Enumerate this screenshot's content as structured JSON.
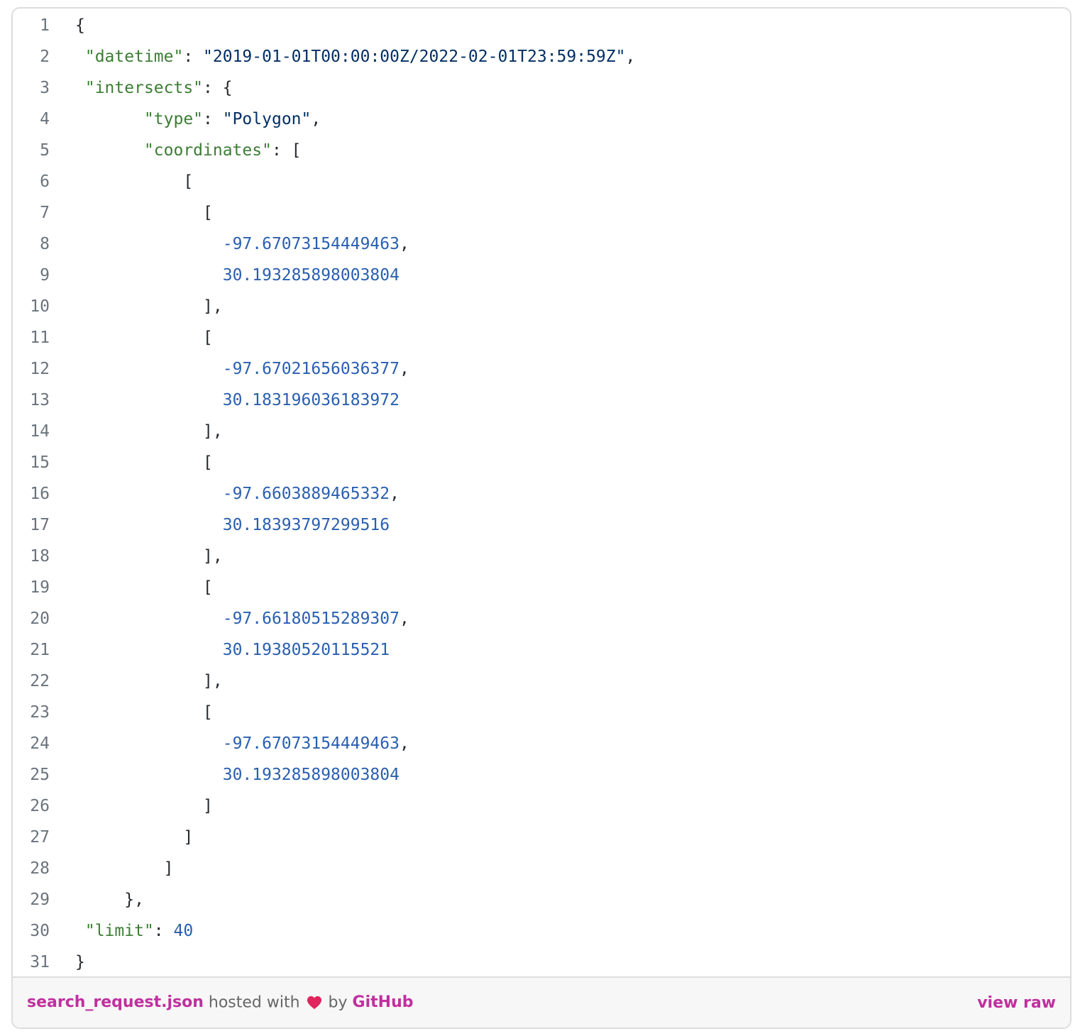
{
  "lines": [
    {
      "n": "1",
      "indent": "",
      "tokens": [
        {
          "t": "{",
          "c": "p"
        }
      ]
    },
    {
      "n": "2",
      "indent": " ",
      "tokens": [
        {
          "t": "\"datetime\"",
          "c": "k"
        },
        {
          "t": ": ",
          "c": "p"
        },
        {
          "t": "\"2019-01-01T00:00:00Z/2022-02-01T23:59:59Z\"",
          "c": "s"
        },
        {
          "t": ",",
          "c": "p"
        }
      ]
    },
    {
      "n": "3",
      "indent": " ",
      "tokens": [
        {
          "t": "\"intersects\"",
          "c": "k"
        },
        {
          "t": ": {",
          "c": "p"
        }
      ]
    },
    {
      "n": "4",
      "indent": "       ",
      "tokens": [
        {
          "t": "\"type\"",
          "c": "k"
        },
        {
          "t": ": ",
          "c": "p"
        },
        {
          "t": "\"Polygon\"",
          "c": "s"
        },
        {
          "t": ",",
          "c": "p"
        }
      ]
    },
    {
      "n": "5",
      "indent": "       ",
      "tokens": [
        {
          "t": "\"coordinates\"",
          "c": "k"
        },
        {
          "t": ": [",
          "c": "p"
        }
      ]
    },
    {
      "n": "6",
      "indent": "           ",
      "tokens": [
        {
          "t": "[",
          "c": "p"
        }
      ]
    },
    {
      "n": "7",
      "indent": "             ",
      "tokens": [
        {
          "t": "[",
          "c": "p"
        }
      ]
    },
    {
      "n": "8",
      "indent": "               ",
      "tokens": [
        {
          "t": "-97.67073154449463",
          "c": "n"
        },
        {
          "t": ",",
          "c": "p"
        }
      ]
    },
    {
      "n": "9",
      "indent": "               ",
      "tokens": [
        {
          "t": "30.193285898003804",
          "c": "n"
        }
      ]
    },
    {
      "n": "10",
      "indent": "             ",
      "tokens": [
        {
          "t": "],",
          "c": "p"
        }
      ]
    },
    {
      "n": "11",
      "indent": "             ",
      "tokens": [
        {
          "t": "[",
          "c": "p"
        }
      ]
    },
    {
      "n": "12",
      "indent": "               ",
      "tokens": [
        {
          "t": "-97.67021656036377",
          "c": "n"
        },
        {
          "t": ",",
          "c": "p"
        }
      ]
    },
    {
      "n": "13",
      "indent": "               ",
      "tokens": [
        {
          "t": "30.183196036183972",
          "c": "n"
        }
      ]
    },
    {
      "n": "14",
      "indent": "             ",
      "tokens": [
        {
          "t": "],",
          "c": "p"
        }
      ]
    },
    {
      "n": "15",
      "indent": "             ",
      "tokens": [
        {
          "t": "[",
          "c": "p"
        }
      ]
    },
    {
      "n": "16",
      "indent": "               ",
      "tokens": [
        {
          "t": "-97.6603889465332",
          "c": "n"
        },
        {
          "t": ",",
          "c": "p"
        }
      ]
    },
    {
      "n": "17",
      "indent": "               ",
      "tokens": [
        {
          "t": "30.18393797299516",
          "c": "n"
        }
      ]
    },
    {
      "n": "18",
      "indent": "             ",
      "tokens": [
        {
          "t": "],",
          "c": "p"
        }
      ]
    },
    {
      "n": "19",
      "indent": "             ",
      "tokens": [
        {
          "t": "[",
          "c": "p"
        }
      ]
    },
    {
      "n": "20",
      "indent": "               ",
      "tokens": [
        {
          "t": "-97.66180515289307",
          "c": "n"
        },
        {
          "t": ",",
          "c": "p"
        }
      ]
    },
    {
      "n": "21",
      "indent": "               ",
      "tokens": [
        {
          "t": "30.19380520115521",
          "c": "n"
        }
      ]
    },
    {
      "n": "22",
      "indent": "             ",
      "tokens": [
        {
          "t": "],",
          "c": "p"
        }
      ]
    },
    {
      "n": "23",
      "indent": "             ",
      "tokens": [
        {
          "t": "[",
          "c": "p"
        }
      ]
    },
    {
      "n": "24",
      "indent": "               ",
      "tokens": [
        {
          "t": "-97.67073154449463",
          "c": "n"
        },
        {
          "t": ",",
          "c": "p"
        }
      ]
    },
    {
      "n": "25",
      "indent": "               ",
      "tokens": [
        {
          "t": "30.193285898003804",
          "c": "n"
        }
      ]
    },
    {
      "n": "26",
      "indent": "             ",
      "tokens": [
        {
          "t": "]",
          "c": "p"
        }
      ]
    },
    {
      "n": "27",
      "indent": "           ",
      "tokens": [
        {
          "t": "]",
          "c": "p"
        }
      ]
    },
    {
      "n": "28",
      "indent": "         ",
      "tokens": [
        {
          "t": "]",
          "c": "p"
        }
      ]
    },
    {
      "n": "29",
      "indent": "     ",
      "tokens": [
        {
          "t": "},",
          "c": "p"
        }
      ]
    },
    {
      "n": "30",
      "indent": " ",
      "tokens": [
        {
          "t": "\"limit\"",
          "c": "k"
        },
        {
          "t": ": ",
          "c": "p"
        },
        {
          "t": "40",
          "c": "n"
        }
      ]
    },
    {
      "n": "31",
      "indent": "",
      "tokens": [
        {
          "t": "}",
          "c": "p"
        }
      ]
    }
  ],
  "footer": {
    "filename": "search_request.json",
    "hosted_text": " hosted with ",
    "heart_icon": "heart-icon",
    "by_text": " by ",
    "github_label": "GitHub",
    "view_raw_label": "view raw"
  },
  "colors": {
    "key": "#3c7d34",
    "string": "#032f62",
    "number": "#2a5fb0",
    "link": "#c0309f",
    "heart": "#e0245e"
  }
}
